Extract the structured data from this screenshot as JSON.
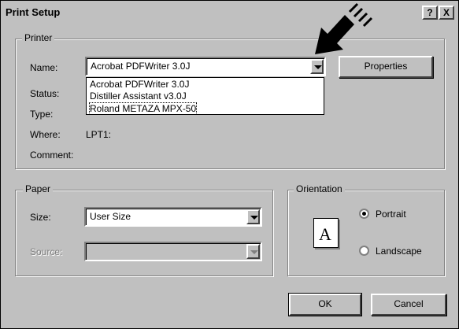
{
  "window": {
    "title": "Print Setup",
    "help_label": "?",
    "close_label": "X"
  },
  "printer": {
    "group_label": "Printer",
    "name_label": "Name:",
    "name_value": "Acrobat PDFWriter 3.0J",
    "properties_label": "Properties",
    "status_label": "Status:",
    "type_label": "Type:",
    "where_label": "Where:",
    "where_value": "LPT1:",
    "comment_label": "Comment:",
    "dropdown_options": [
      "Acrobat PDFWriter 3.0J",
      "Distiller Assistant v3.0J",
      "Roland METAZA MPX-50"
    ]
  },
  "paper": {
    "group_label": "Paper",
    "size_label": "Size:",
    "size_value": "User Size",
    "source_label": "Source:"
  },
  "orientation": {
    "group_label": "Orientation",
    "page_glyph": "A",
    "portrait_label": "Portrait",
    "landscape_label": "Landscape",
    "selected": "Portrait"
  },
  "buttons": {
    "ok_label": "OK",
    "cancel_label": "Cancel"
  },
  "icons": {
    "arrow": "pointing-arrow-icon",
    "dropdown": "chevron-down-icon"
  }
}
